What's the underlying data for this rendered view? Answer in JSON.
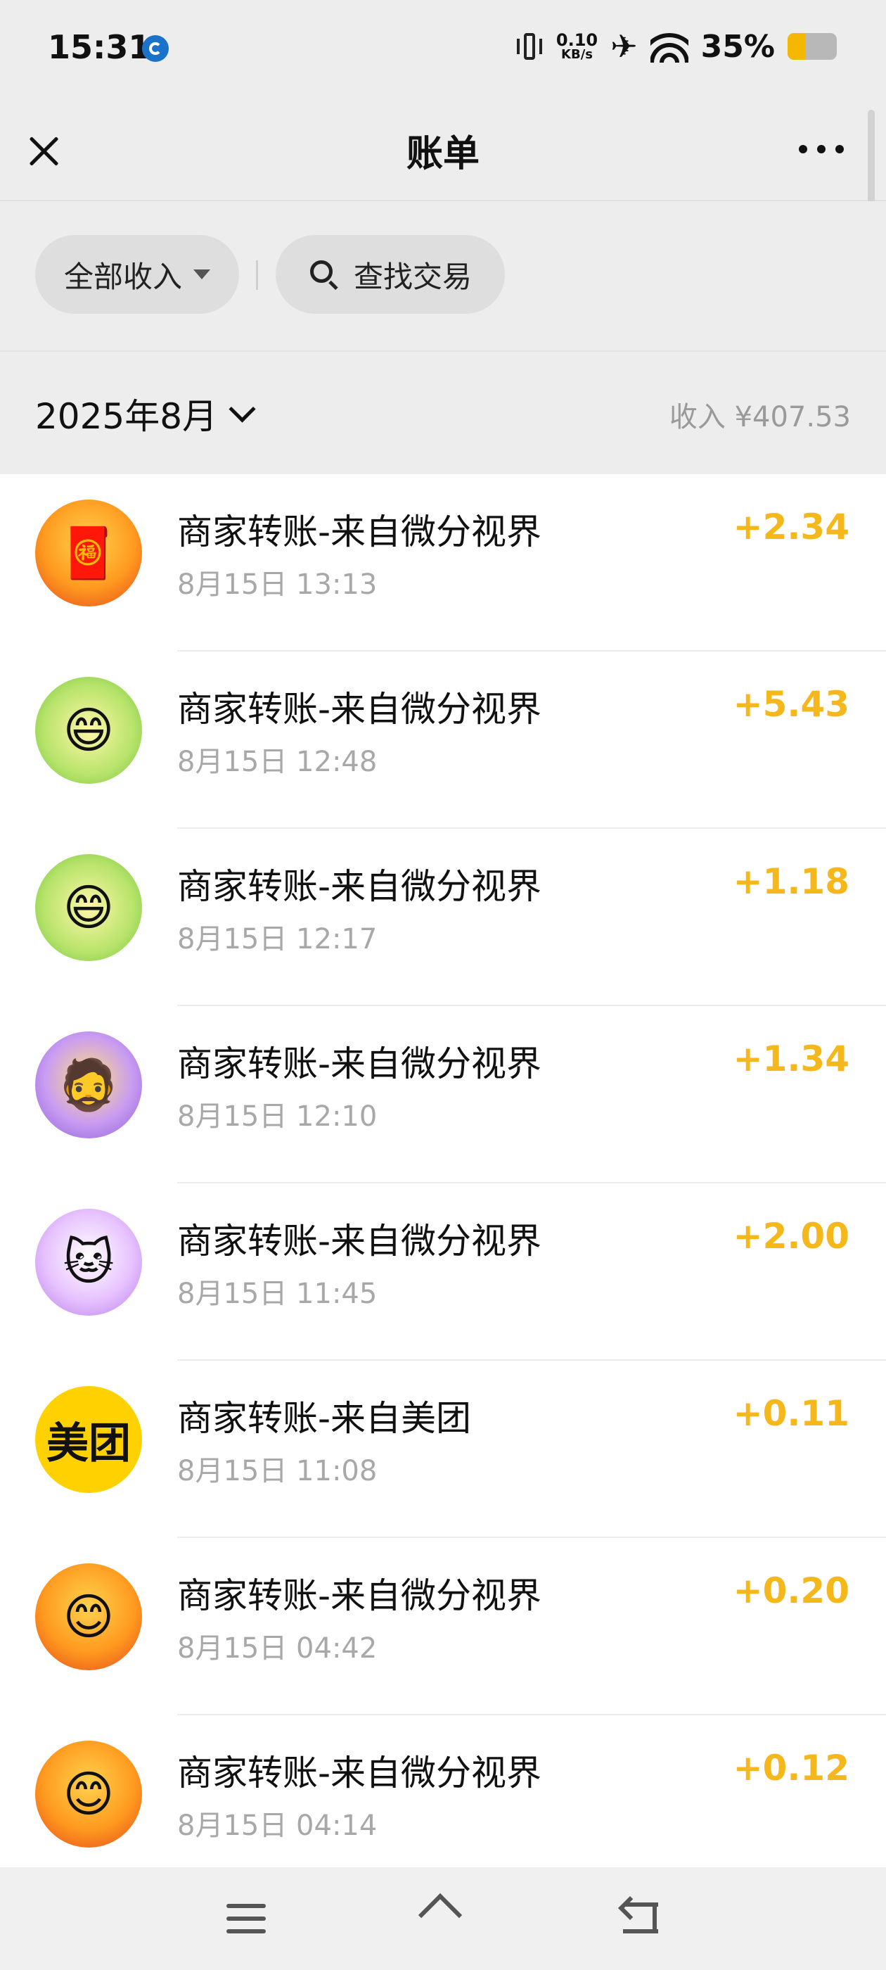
{
  "status_bar": {
    "time": "15:31",
    "net_speed_value": "0.10",
    "net_speed_unit": "KB/s",
    "battery_percent": "35%",
    "battery_level": 0.35,
    "icons": [
      "app-notification-icon",
      "vibrate-icon",
      "airplane-icon",
      "wifi-icon",
      "battery-icon"
    ]
  },
  "header": {
    "title": "账单",
    "close_icon": "close-icon",
    "more_icon": "more-icon"
  },
  "filters": {
    "category_label": "全部收入",
    "search_label": "查找交易"
  },
  "month": {
    "label": "2025年8月",
    "summary": "收入 ¥407.53"
  },
  "transactions": [
    {
      "title": "商家转账-来自微分视界",
      "time": "8月15日 13:13",
      "amount": "+2.34",
      "avatar": "fortune",
      "glyph": "🧧"
    },
    {
      "title": "商家转账-来自微分视界",
      "time": "8月15日 12:48",
      "amount": "+5.43",
      "avatar": "baby",
      "glyph": "😄"
    },
    {
      "title": "商家转账-来自微分视界",
      "time": "8月15日 12:17",
      "amount": "+1.18",
      "avatar": "baby",
      "glyph": "😄"
    },
    {
      "title": "商家转账-来自微分视界",
      "time": "8月15日 12:10",
      "amount": "+1.34",
      "avatar": "god",
      "glyph": "🧔"
    },
    {
      "title": "商家转账-来自微分视界",
      "time": "8月15日 11:45",
      "amount": "+2.00",
      "avatar": "cat",
      "glyph": "🐱"
    },
    {
      "title": "商家转账-来自美团",
      "time": "8月15日 11:08",
      "amount": "+0.11",
      "avatar": "meituan",
      "glyph": "美团"
    },
    {
      "title": "商家转账-来自微分视界",
      "time": "8月15日 04:42",
      "amount": "+0.20",
      "avatar": "fortune",
      "glyph": "😊"
    },
    {
      "title": "商家转账-来自微分视界",
      "time": "8月15日 04:14",
      "amount": "+0.12",
      "avatar": "fortune",
      "glyph": "😊"
    }
  ],
  "colors": {
    "amount": "#f5b81c",
    "background": "#ededed",
    "meituan_brand": "#ffd100"
  },
  "nav_bar": {
    "icons": [
      "menu-icon",
      "home-icon",
      "back-icon"
    ]
  }
}
